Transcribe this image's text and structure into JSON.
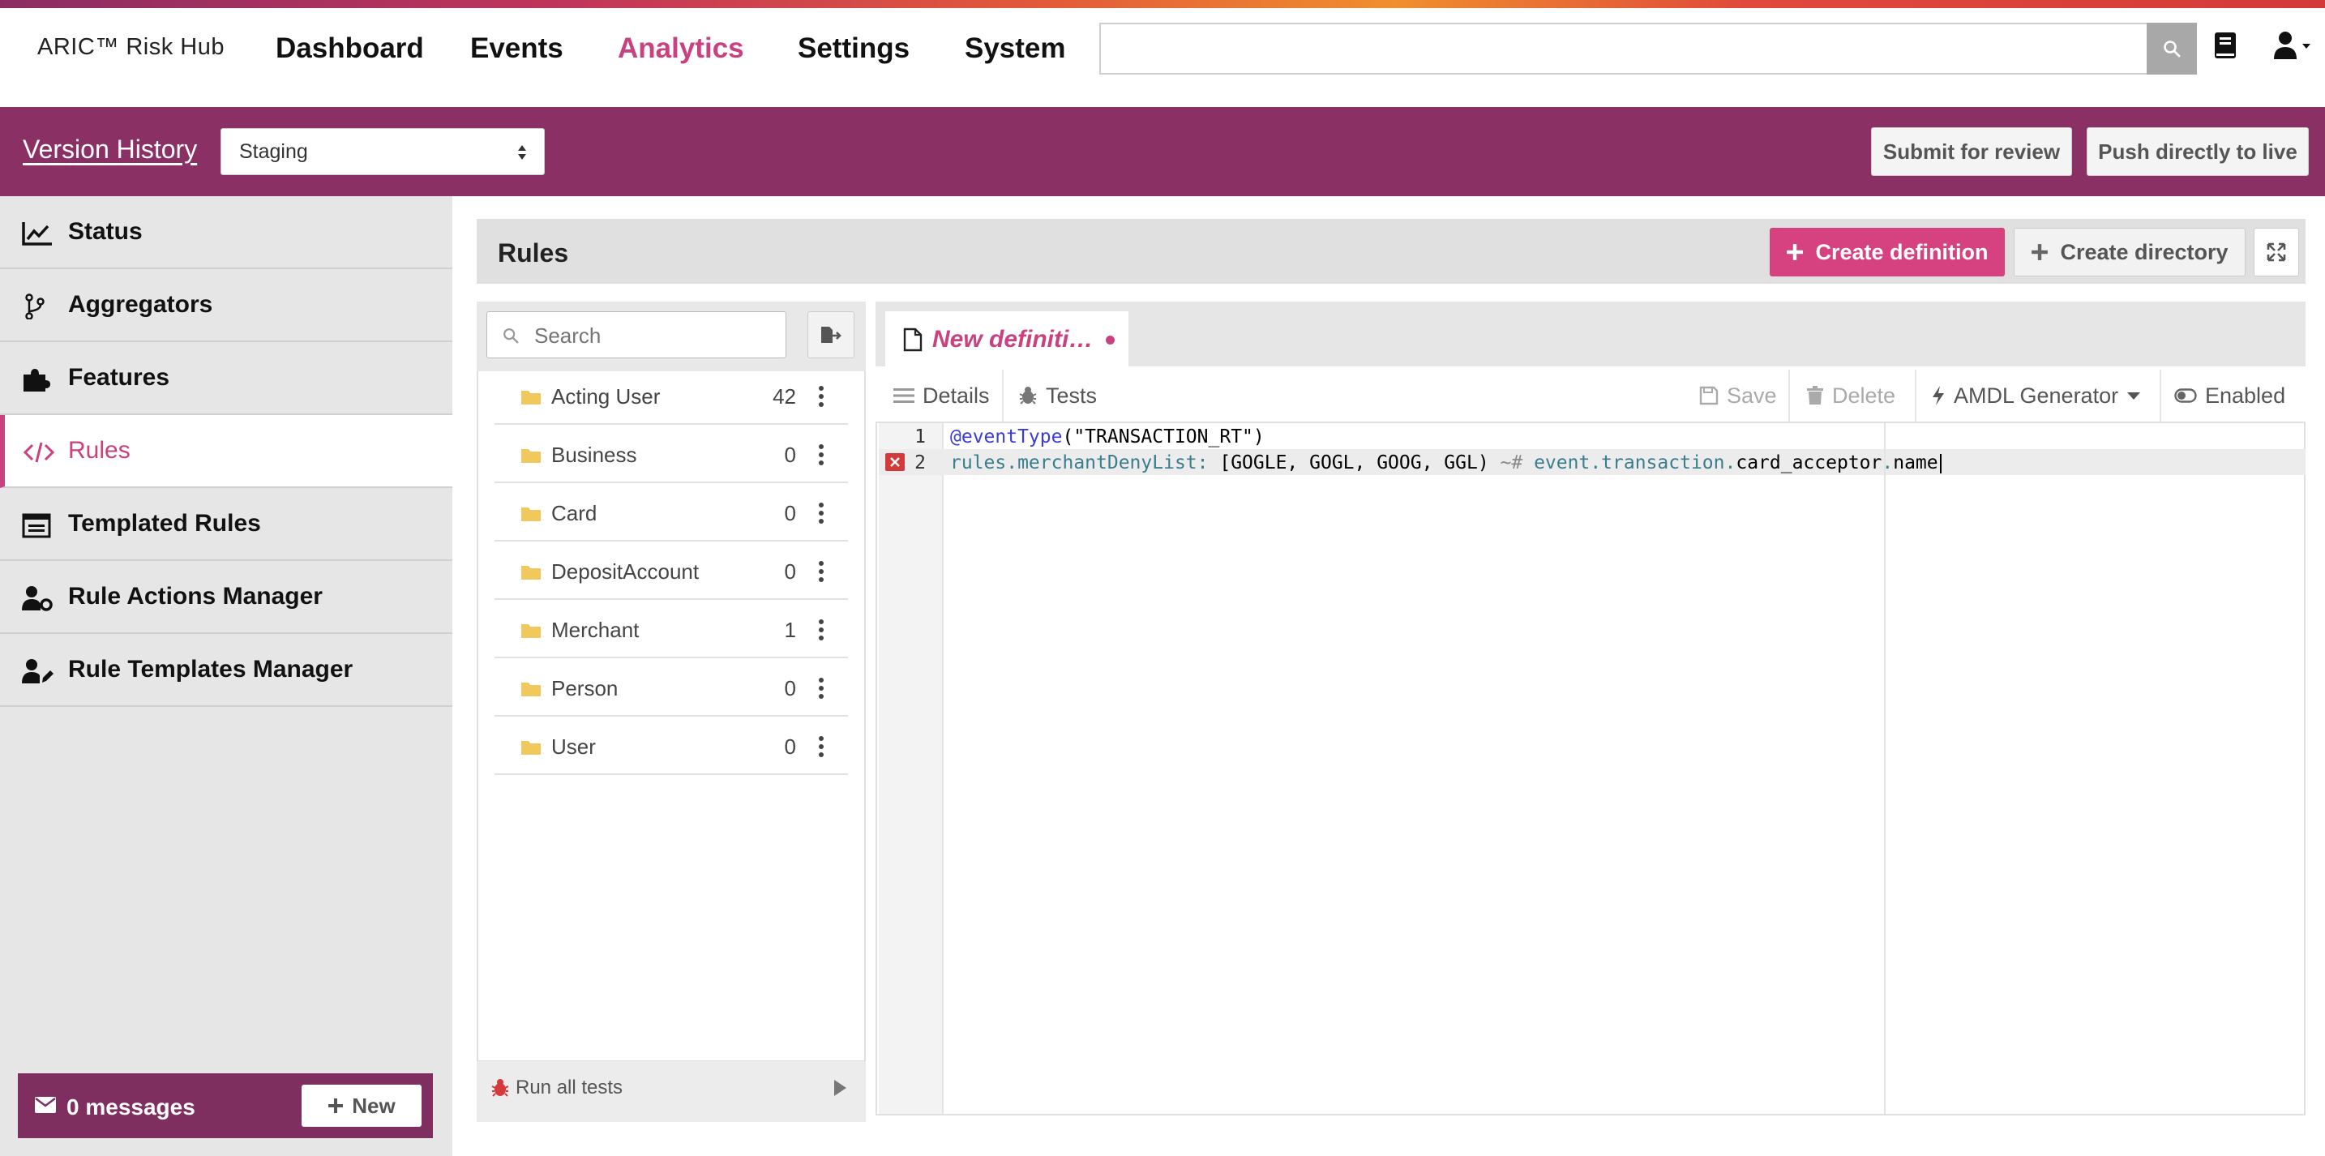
{
  "brand": "ARIC™ Risk Hub",
  "nav": {
    "items": [
      {
        "label": "Dashboard",
        "active": false
      },
      {
        "label": "Events",
        "active": false
      },
      {
        "label": "Analytics",
        "active": true
      },
      {
        "label": "Settings",
        "active": false
      },
      {
        "label": "System",
        "active": false
      }
    ],
    "search_value": ""
  },
  "version_bar": {
    "link": "Version History",
    "environment": "Staging",
    "submit_label": "Submit for review",
    "push_label": "Push directly to live"
  },
  "sidebar": {
    "items": [
      {
        "label": "Status",
        "icon": "chart-line-icon"
      },
      {
        "label": "Aggregators",
        "icon": "branch-icon"
      },
      {
        "label": "Features",
        "icon": "puzzle-icon"
      },
      {
        "label": "Rules",
        "icon": "code-icon",
        "active": true
      },
      {
        "label": "Templated Rules",
        "icon": "template-icon"
      },
      {
        "label": "Rule Actions Manager",
        "icon": "user-cog-icon"
      },
      {
        "label": "Rule Templates Manager",
        "icon": "user-edit-icon"
      }
    ],
    "messages": {
      "label": "0 messages",
      "new_label": "New"
    }
  },
  "rules_panel": {
    "title": "Rules",
    "create_definition": "Create definition",
    "create_directory": "Create directory"
  },
  "tree": {
    "search_placeholder": "Search",
    "folders": [
      {
        "label": "Acting User",
        "count": "42"
      },
      {
        "label": "Business",
        "count": "0"
      },
      {
        "label": "Card",
        "count": "0"
      },
      {
        "label": "DepositAccount",
        "count": "0"
      },
      {
        "label": "Merchant",
        "count": "1"
      },
      {
        "label": "Person",
        "count": "0"
      },
      {
        "label": "User",
        "count": "0"
      }
    ],
    "run_all_tests": "Run all tests"
  },
  "editor": {
    "tab_label": "New definiti…",
    "toolbar": {
      "details": "Details",
      "tests": "Tests",
      "save": "Save",
      "delete": "Delete",
      "generator": "AMDL Generator",
      "enabled": "Enabled"
    },
    "lines": [
      {
        "num": "1",
        "parts": {
          "anno": "@eventType",
          "rest": "(\"TRANSACTION_RT\")"
        }
      },
      {
        "num": "2",
        "parts": {
          "prop": "rules.merchantDenyList:",
          "list": " [GOGLE, GOGL, GOOG, GGL) ",
          "op": "~#",
          "event": " event.transaction.",
          "field": "card_acceptor",
          "dot": ".",
          "name": "name"
        }
      }
    ]
  },
  "colors": {
    "accent": "#c9417f",
    "purple_bar": "#8a3065",
    "create_button": "#d6427f",
    "error": "#d43a3a"
  }
}
